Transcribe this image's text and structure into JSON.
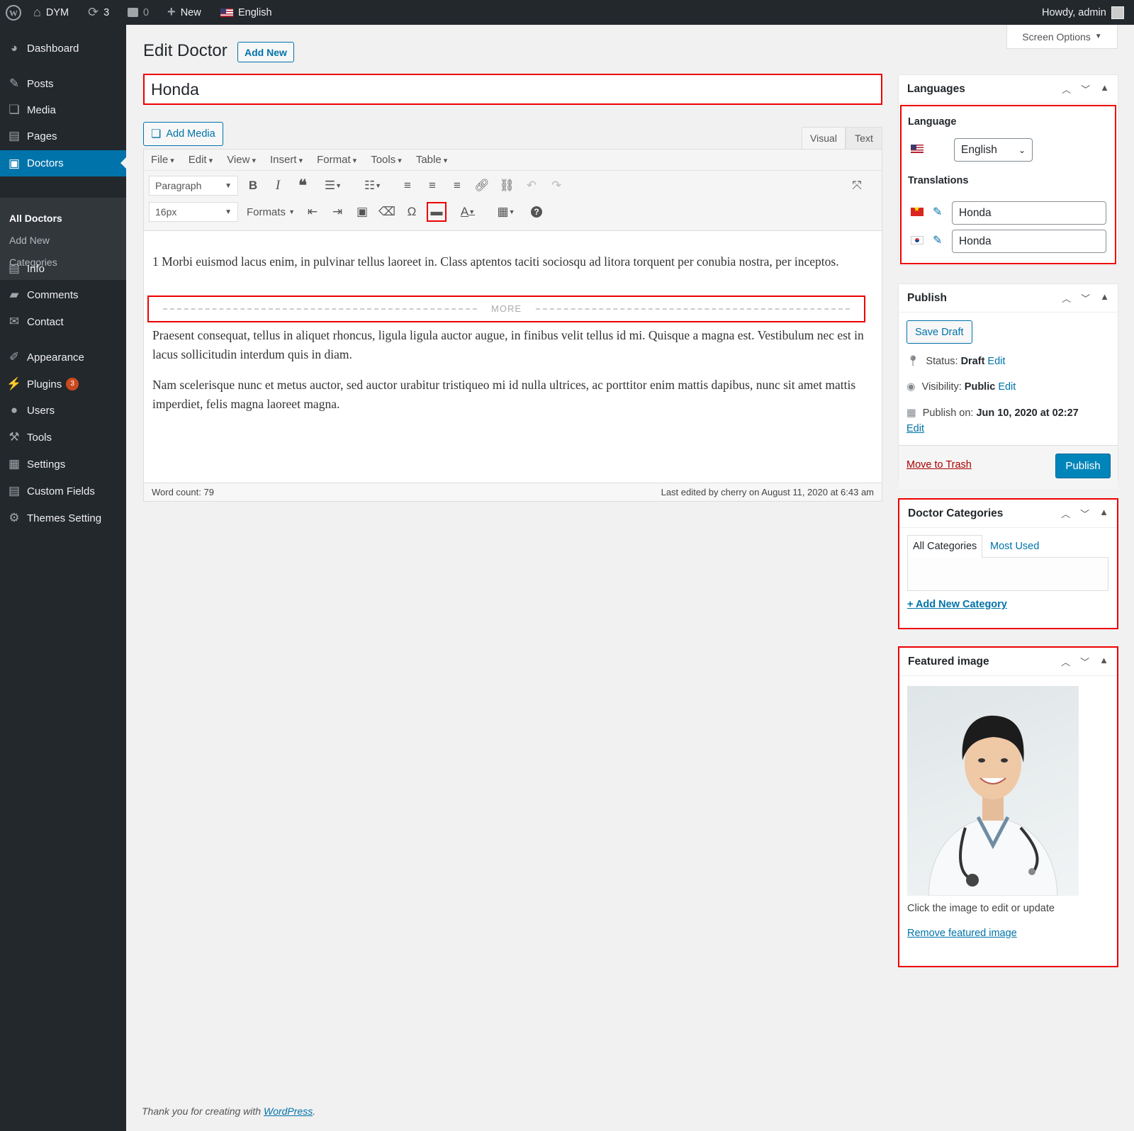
{
  "adminbar": {
    "site_name": "DYM",
    "updates_count": "3",
    "comments_count": "0",
    "new_label": "New",
    "language": "English",
    "howdy": "Howdy, admin"
  },
  "sidebar": {
    "items": [
      {
        "label": "Dashboard",
        "icon": "dashboard-icon"
      },
      {
        "label": "Posts",
        "icon": "pin-icon"
      },
      {
        "label": "Media",
        "icon": "media-icon"
      },
      {
        "label": "Pages",
        "icon": "pages-icon"
      },
      {
        "label": "Doctors",
        "icon": "doctors-icon"
      },
      {
        "label": "Info",
        "icon": "info-icon"
      },
      {
        "label": "Comments",
        "icon": "comments-icon"
      },
      {
        "label": "Contact",
        "icon": "mail-icon"
      },
      {
        "label": "Appearance",
        "icon": "brush-icon"
      },
      {
        "label": "Plugins",
        "icon": "plugin-icon",
        "badge": "3"
      },
      {
        "label": "Users",
        "icon": "user-icon"
      },
      {
        "label": "Tools",
        "icon": "wrench-icon"
      },
      {
        "label": "Settings",
        "icon": "settings-icon"
      },
      {
        "label": "Custom Fields",
        "icon": "fields-icon"
      },
      {
        "label": "Themes Setting",
        "icon": "gear-icon"
      }
    ],
    "submenu": [
      "All Doctors",
      "Add New",
      "Categories"
    ]
  },
  "header": {
    "screen_options": "Screen Options",
    "title": "Edit Doctor",
    "add_new": "Add New"
  },
  "post": {
    "title": "Honda",
    "add_media": "Add Media",
    "tab_visual": "Visual",
    "tab_text": "Text"
  },
  "editor": {
    "menubar": [
      "File",
      "Edit",
      "View",
      "Insert",
      "Format",
      "Tools",
      "Table"
    ],
    "paragraph_select": "Paragraph",
    "fontsize_select": "16px",
    "formats": "Formats",
    "paragraphs": [
      "1 Morbi euismod lacus enim, in pulvinar tellus laoreet in. Class aptentos taciti sociosqu ad litora torquent per conubia nostra, per inceptos.",
      "Praesent consequat, tellus in aliquet rhoncus, ligula ligula auctor augue, in finibus velit tellus id mi. Quisque a magna est. Vestibulum nec est in lacus sollicitudin interdum quis in diam.",
      "Nam scelerisque nunc et metus auctor, sed auctor urabitur tristiqueo mi id nulla ultrices, ac porttitor enim mattis dapibus, nunc sit amet mattis imperdiet, felis magna laoreet magna."
    ],
    "more_label": "MORE",
    "word_count": "Word count: 79",
    "last_edited": "Last edited by cherry on August 11, 2020 at 6:43 am"
  },
  "languages_box": {
    "title": "Languages",
    "language_label": "Language",
    "language_value": "English",
    "translations_label": "Translations",
    "translations": [
      "Honda",
      "Honda"
    ]
  },
  "publish_box": {
    "title": "Publish",
    "save_draft": "Save Draft",
    "status_label": "Status:",
    "status_value": "Draft",
    "visibility_label": "Visibility:",
    "visibility_value": "Public",
    "publish_on_label": "Publish on:",
    "publish_on_value": "Jun 10, 2020 at 02:27",
    "edit": "Edit",
    "move_to_trash": "Move to Trash",
    "publish": "Publish"
  },
  "categories_box": {
    "title": "Doctor Categories",
    "tab_all": "All Categories",
    "tab_most_used": "Most Used",
    "add_new": "+ Add New Category"
  },
  "featured_box": {
    "title": "Featured image",
    "hint": "Click the image to edit or update",
    "remove": "Remove featured image"
  },
  "footer": {
    "text": "Thank you for creating with",
    "link": "WordPress",
    "end": "."
  },
  "colors": {
    "accent": "#0073aa",
    "highlight": "#ee0000",
    "sidebar_bg": "#23282d",
    "publish_button": "#0085ba"
  }
}
